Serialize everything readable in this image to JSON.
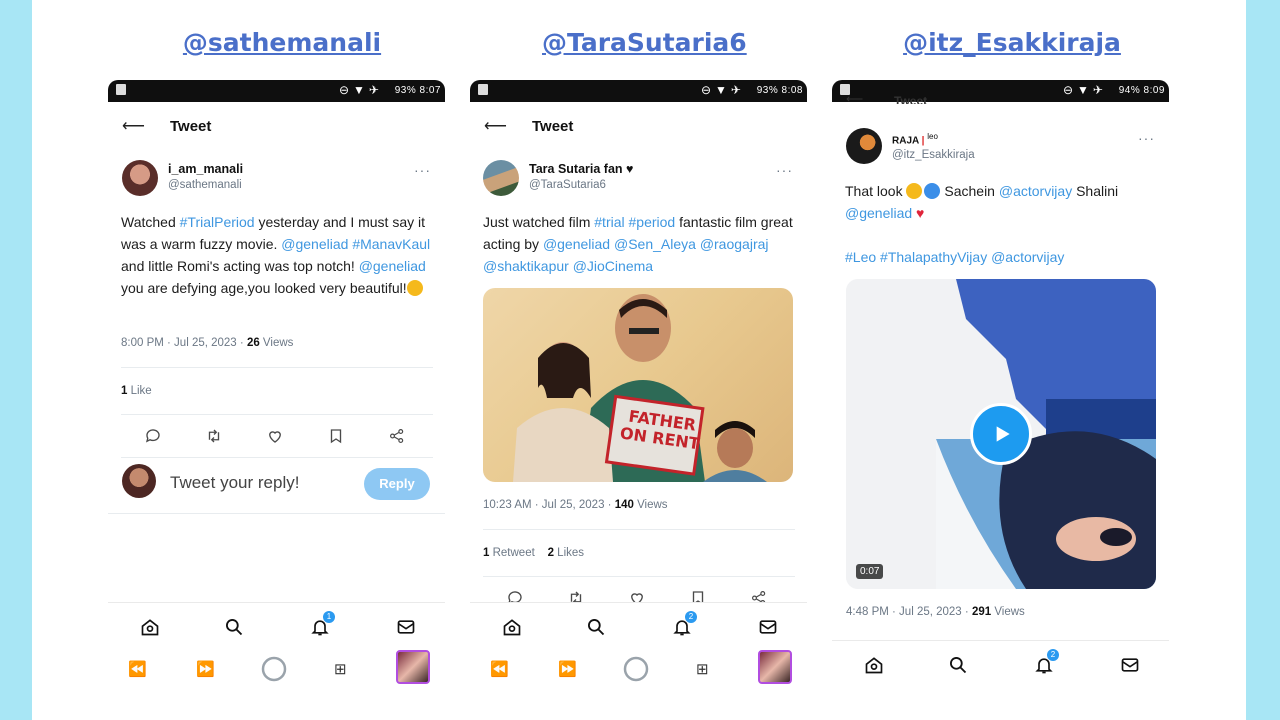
{
  "headers": [
    "@sathemanali",
    "@TaraSutaria6",
    "@itz_Esakkiraja"
  ],
  "colors": {
    "page_bg": "#a8e6f5",
    "link": "#3f97e0",
    "handle": "#4a6fc9",
    "badge": "#2b9af0"
  },
  "phone1": {
    "status": "93% 8:07",
    "title": "Tweet",
    "author_name": "i_am_manali",
    "author_handle": "@sathemanali",
    "text": [
      {
        "t": "Watched ",
        "link": false
      },
      {
        "t": "#TrialPeriod",
        "link": true
      },
      {
        "t": " yesterday and I must say it was a warm fuzzy movie. ",
        "link": false
      },
      {
        "t": "@geneliad",
        "link": true
      },
      {
        "t": " ",
        "link": false
      },
      {
        "t": "#ManavKaul",
        "link": true
      },
      {
        "t": " and little Romi's acting was top notch! ",
        "link": false
      },
      {
        "t": "@geneliad",
        "link": true
      },
      {
        "t": " you are defying age,you looked very beautiful!",
        "link": false
      }
    ],
    "time": "8:00 PM · Jul 25, 2023 · ",
    "views_count": "26",
    "views_label": " Views",
    "likes_count": "1",
    "likes_label": " Like",
    "reply_placeholder": "Tweet your reply!",
    "reply_button": "Reply",
    "notif_badge": "1"
  },
  "phone2": {
    "status": "93% 8:08",
    "title": "Tweet",
    "author_name": "Tara Sutaria fan",
    "author_handle": "@TaraSutaria6",
    "text": [
      {
        "t": "Just watched film ",
        "link": false
      },
      {
        "t": "#trial",
        "link": true
      },
      {
        "t": " ",
        "link": false
      },
      {
        "t": "#period",
        "link": true
      },
      {
        "t": " fantastic film great acting by ",
        "link": false
      },
      {
        "t": "@geneliad",
        "link": true
      },
      {
        "t": " ",
        "link": false
      },
      {
        "t": "@Sen_Aleya",
        "link": true
      },
      {
        "t": " ",
        "link": false
      },
      {
        "t": "@raogajraj",
        "link": true
      },
      {
        "t": " ",
        "link": false
      },
      {
        "t": "@shaktikapur",
        "link": true
      },
      {
        "t": " ",
        "link": false
      },
      {
        "t": "@JioCinema",
        "link": true
      }
    ],
    "poster_text_1": "FATHER",
    "poster_text_2": "ON RENT",
    "time": "10:23 AM · Jul 25, 2023 · ",
    "views_count": "140",
    "views_label": " Views",
    "retweets_count": "1",
    "retweets_label": " Retweet",
    "likes_count": "2",
    "likes_label": " Likes",
    "notif_badge": "2"
  },
  "phone3": {
    "status": "94% 8:09",
    "title": "Tweet",
    "author_name": "RAJA",
    "author_name_suffix": "leo",
    "author_handle": "@itz_Esakkiraja",
    "text_line1_a": "That look ",
    "text_line1_b": " Sachein ",
    "text_line1_link": "@actorvijay",
    "text_line1_c": " Shalini",
    "text_line2_link": "@geneliad",
    "tags": [
      {
        "t": "#Leo",
        "link": true
      },
      {
        "t": " ",
        "link": false
      },
      {
        "t": "#ThalapathyVijay",
        "link": true
      },
      {
        "t": "   ",
        "link": false
      },
      {
        "t": "@actorvijay",
        "link": true
      }
    ],
    "video_duration": "0:07",
    "time": "4:48 PM · Jul 25, 2023 · ",
    "views_count": "291",
    "views_label": " Views",
    "notif_badge": "2"
  }
}
